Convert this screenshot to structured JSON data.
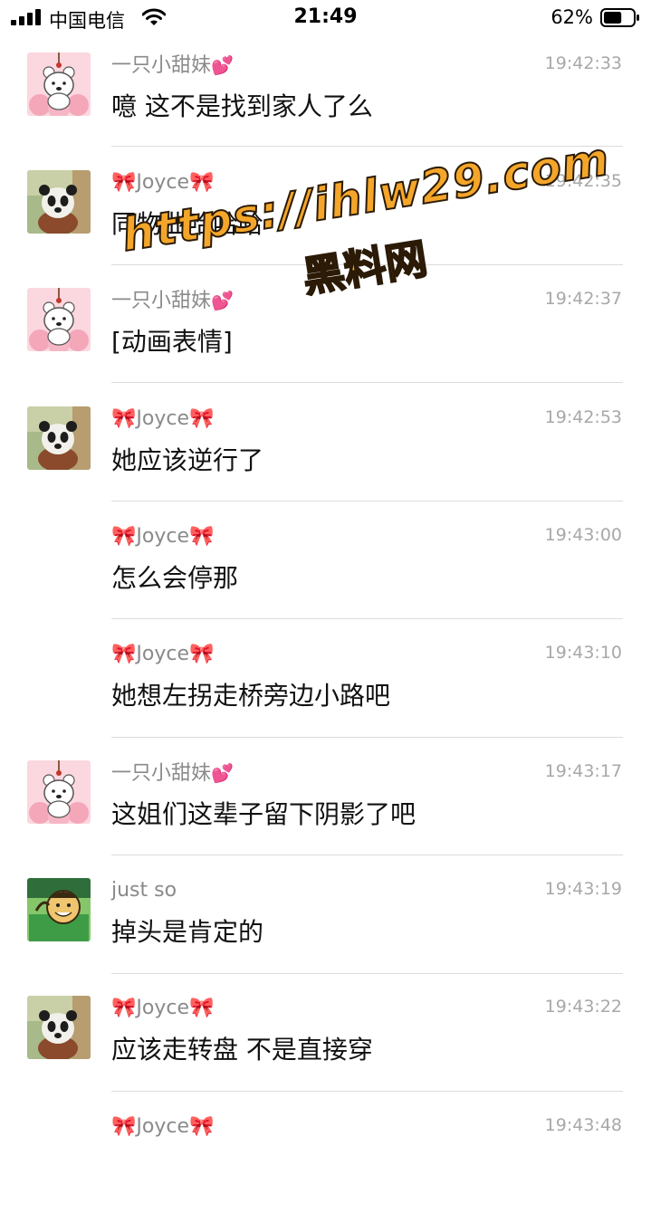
{
  "status_bar": {
    "carrier": "中国电信",
    "time": "21:49",
    "battery_percent": "62%",
    "battery_level": 0.62,
    "icons": [
      "signal-icon",
      "wifi-icon",
      "battery-icon"
    ]
  },
  "senders": {
    "xiaotianmei": "一只小甜妹",
    "joyce": "Joyce",
    "justso": "just so"
  },
  "decorations": {
    "bow": "🎀",
    "heart": "💕"
  },
  "messages": [
    {
      "sender": "一只小甜妹",
      "time": "19:42:33",
      "text": "噫 这不是找到家人了么",
      "avatar": "bear-avatar"
    },
    {
      "sender": "Joyce",
      "time": "19:42:35",
      "text": "同物业哈哈哈",
      "avatar": "panda-avatar"
    },
    {
      "sender": "一只小甜妹",
      "time": "19:42:37",
      "text": "[动画表情]",
      "avatar": "bear-avatar"
    },
    {
      "sender": "Joyce",
      "time": "19:42:53",
      "text": "她应该逆行了",
      "avatar": "panda-avatar"
    },
    {
      "sender": "Joyce",
      "time": "19:43:00",
      "text": "怎么会停那",
      "avatar": ""
    },
    {
      "sender": "Joyce",
      "time": "19:43:10",
      "text": "她想左拐走桥旁边小路吧",
      "avatar": ""
    },
    {
      "sender": "一只小甜妹",
      "time": "19:43:17",
      "text": "这姐们这辈子留下阴影了吧",
      "avatar": "bear-avatar"
    },
    {
      "sender": "just so",
      "time": "19:43:19",
      "text": "掉头是肯定的",
      "avatar": "cartoon-avatar"
    },
    {
      "sender": "Joyce",
      "time": "19:43:22",
      "text": "应该走转盘 不是直接穿",
      "avatar": "panda-avatar"
    },
    {
      "sender": "Joyce",
      "time": "19:43:48",
      "text": "",
      "avatar": ""
    }
  ],
  "watermark": {
    "url": "https://ihlw29.com",
    "name": "黑料网"
  }
}
